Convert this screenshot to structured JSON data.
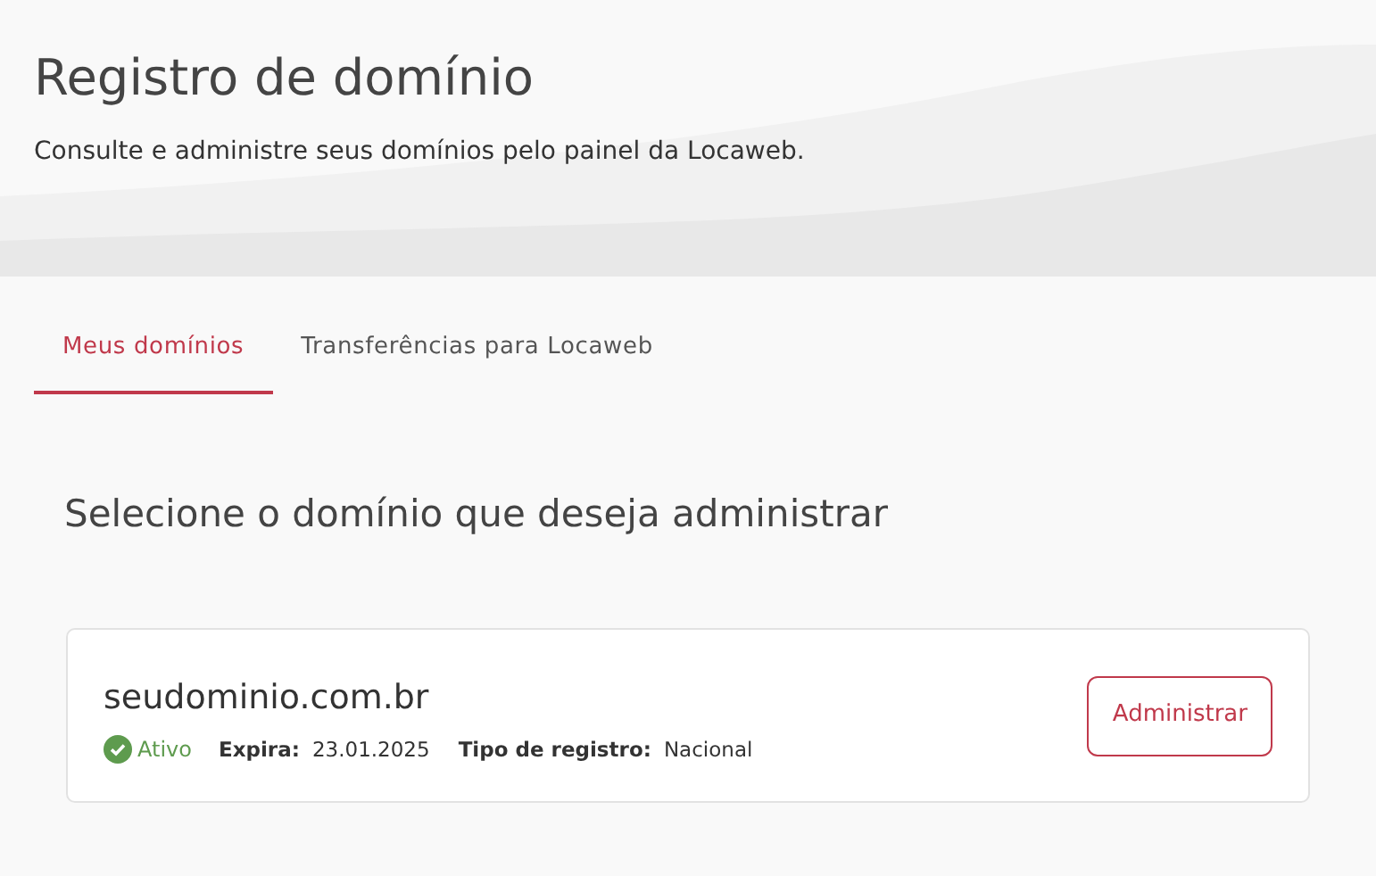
{
  "header": {
    "title": "Registro de domínio",
    "subtitle": "Consulte e administre seus domínios pelo painel da Locaweb."
  },
  "tabs": [
    {
      "label": "Meus domínios",
      "selected": true
    },
    {
      "label": "Transferências para Locaweb",
      "selected": false
    }
  ],
  "section_title": "Selecione o domínio que deseja administrar",
  "domains": [
    {
      "name": "seudominio.com.br",
      "status": {
        "label": "Ativo",
        "kind": "active"
      },
      "expires_label": "Expira:",
      "expires": "23.01.2025",
      "type_label": "Tipo de registro:",
      "type": "Nacional",
      "button": "Administrar"
    }
  ]
}
